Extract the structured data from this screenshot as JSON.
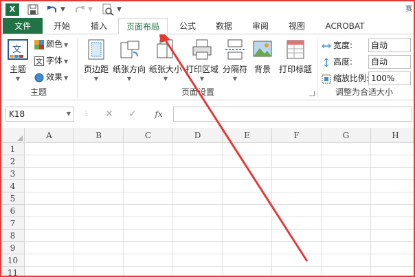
{
  "qat": {
    "app_logo": "X",
    "icons": [
      "excel-logo",
      "save-icon",
      "undo-icon",
      "redo-icon",
      "print-preview-icon"
    ],
    "window_glyph": "赛"
  },
  "tabs": {
    "file": "文件",
    "home": "开始",
    "insert": "插入",
    "page_layout": "页面布局",
    "formulas": "公式",
    "data": "数据",
    "review": "审阅",
    "view": "视图",
    "acrobat": "ACROBAT"
  },
  "ribbon": {
    "themes_group": {
      "label": "主题",
      "themes_btn": "主题",
      "colors": "颜色",
      "fonts": "字体",
      "effects": "效果"
    },
    "page_setup_group": {
      "label": "页面设置",
      "margins": "页边距",
      "orientation": "纸张方向",
      "size": "纸张大小",
      "print_area": "打印区域",
      "breaks": "分隔符",
      "background": "背景",
      "print_titles": "打印标题"
    },
    "scale_group": {
      "label": "调整为合适大小",
      "width_label": "宽度:",
      "width_value": "自动",
      "height_label": "高度:",
      "height_value": "自动",
      "scale_label": "缩放比例:",
      "scale_value": "100%"
    },
    "accent_color": "#217346"
  },
  "formula_bar": {
    "name_box": "K18",
    "fx": "fx",
    "content": ""
  },
  "grid": {
    "columns": [
      "A",
      "B",
      "C",
      "D",
      "E",
      "F",
      "G",
      "H"
    ],
    "rows": [
      "1",
      "2",
      "3",
      "4",
      "5",
      "6",
      "7",
      "8",
      "9",
      "10",
      "11"
    ]
  },
  "annotation": {
    "color": "#e53935"
  }
}
